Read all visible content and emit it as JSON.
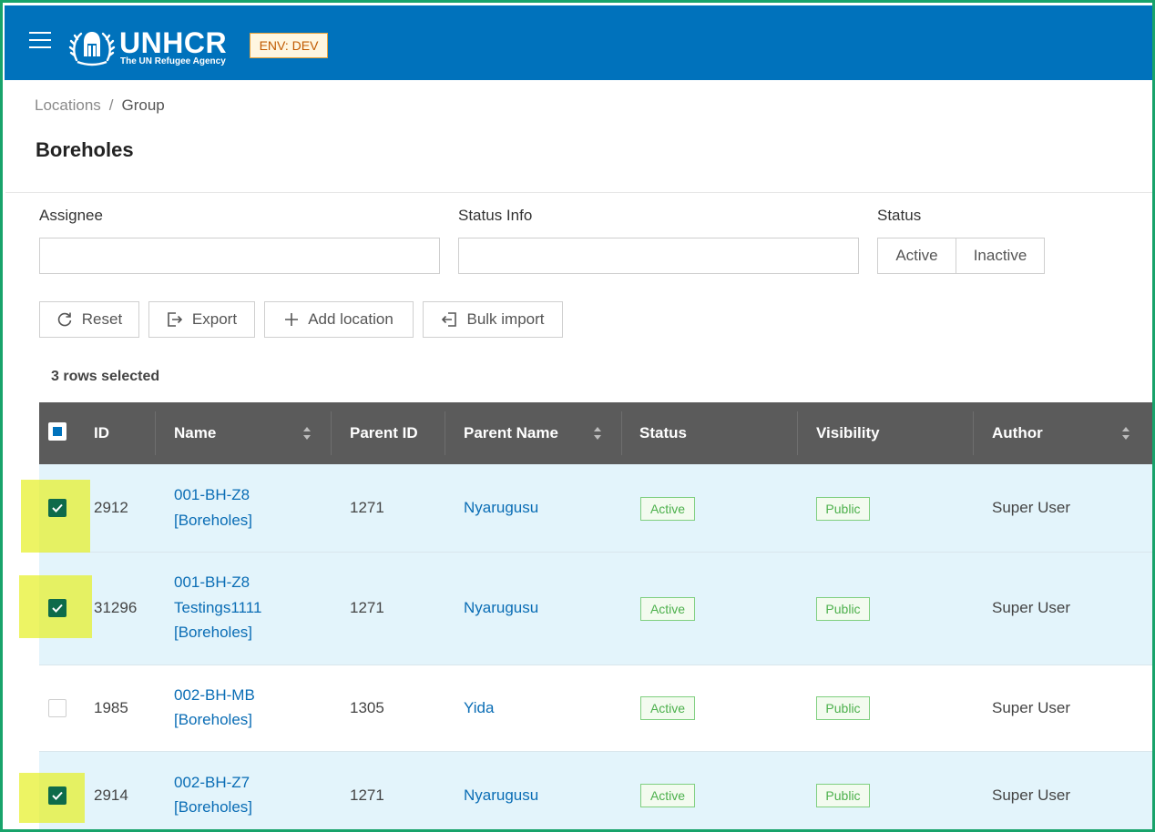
{
  "header": {
    "brand_name": "UNHCR",
    "brand_tagline": "The UN Refugee Agency",
    "env_badge": "ENV: DEV",
    "colors": {
      "bar": "#0072bc",
      "env_badge_text": "#c05a00"
    }
  },
  "breadcrumb": {
    "parent": "Locations",
    "separator": "/",
    "current": "Group"
  },
  "page": {
    "title": "Boreholes"
  },
  "filters": {
    "assignee": {
      "label": "Assignee",
      "value": ""
    },
    "status_info": {
      "label": "Status Info",
      "value": ""
    },
    "status": {
      "label": "Status",
      "options": [
        "Active",
        "Inactive"
      ]
    }
  },
  "actions": {
    "reset": "Reset",
    "export": "Export",
    "add_location": "Add location",
    "bulk_import": "Bulk import"
  },
  "selection": {
    "summary": "3 rows selected"
  },
  "table": {
    "columns": {
      "id": "ID",
      "name": "Name",
      "parent_id": "Parent ID",
      "parent_name": "Parent Name",
      "status": "Status",
      "visibility": "Visibility",
      "author": "Author"
    },
    "rows": [
      {
        "selected": true,
        "id": "2912",
        "name_lines": [
          "001-BH-Z8",
          "[Boreholes]"
        ],
        "parent_id": "1271",
        "parent_name": "Nyarugusu",
        "status": "Active",
        "visibility": "Public",
        "author": "Super User"
      },
      {
        "selected": true,
        "id": "31296",
        "name_lines": [
          "001-BH-Z8",
          "Testings1111",
          "[Boreholes]"
        ],
        "parent_id": "1271",
        "parent_name": "Nyarugusu",
        "status": "Active",
        "visibility": "Public",
        "author": "Super User"
      },
      {
        "selected": false,
        "id": "1985",
        "name_lines": [
          "002-BH-MB",
          "[Boreholes]"
        ],
        "parent_id": "1305",
        "parent_name": "Yida",
        "status": "Active",
        "visibility": "Public",
        "author": "Super User"
      },
      {
        "selected": true,
        "id": "2914",
        "name_lines": [
          "002-BH-Z7",
          "[Boreholes]"
        ],
        "parent_id": "1271",
        "parent_name": "Nyarugusu",
        "status": "Active",
        "visibility": "Public",
        "author": "Super User"
      }
    ]
  }
}
